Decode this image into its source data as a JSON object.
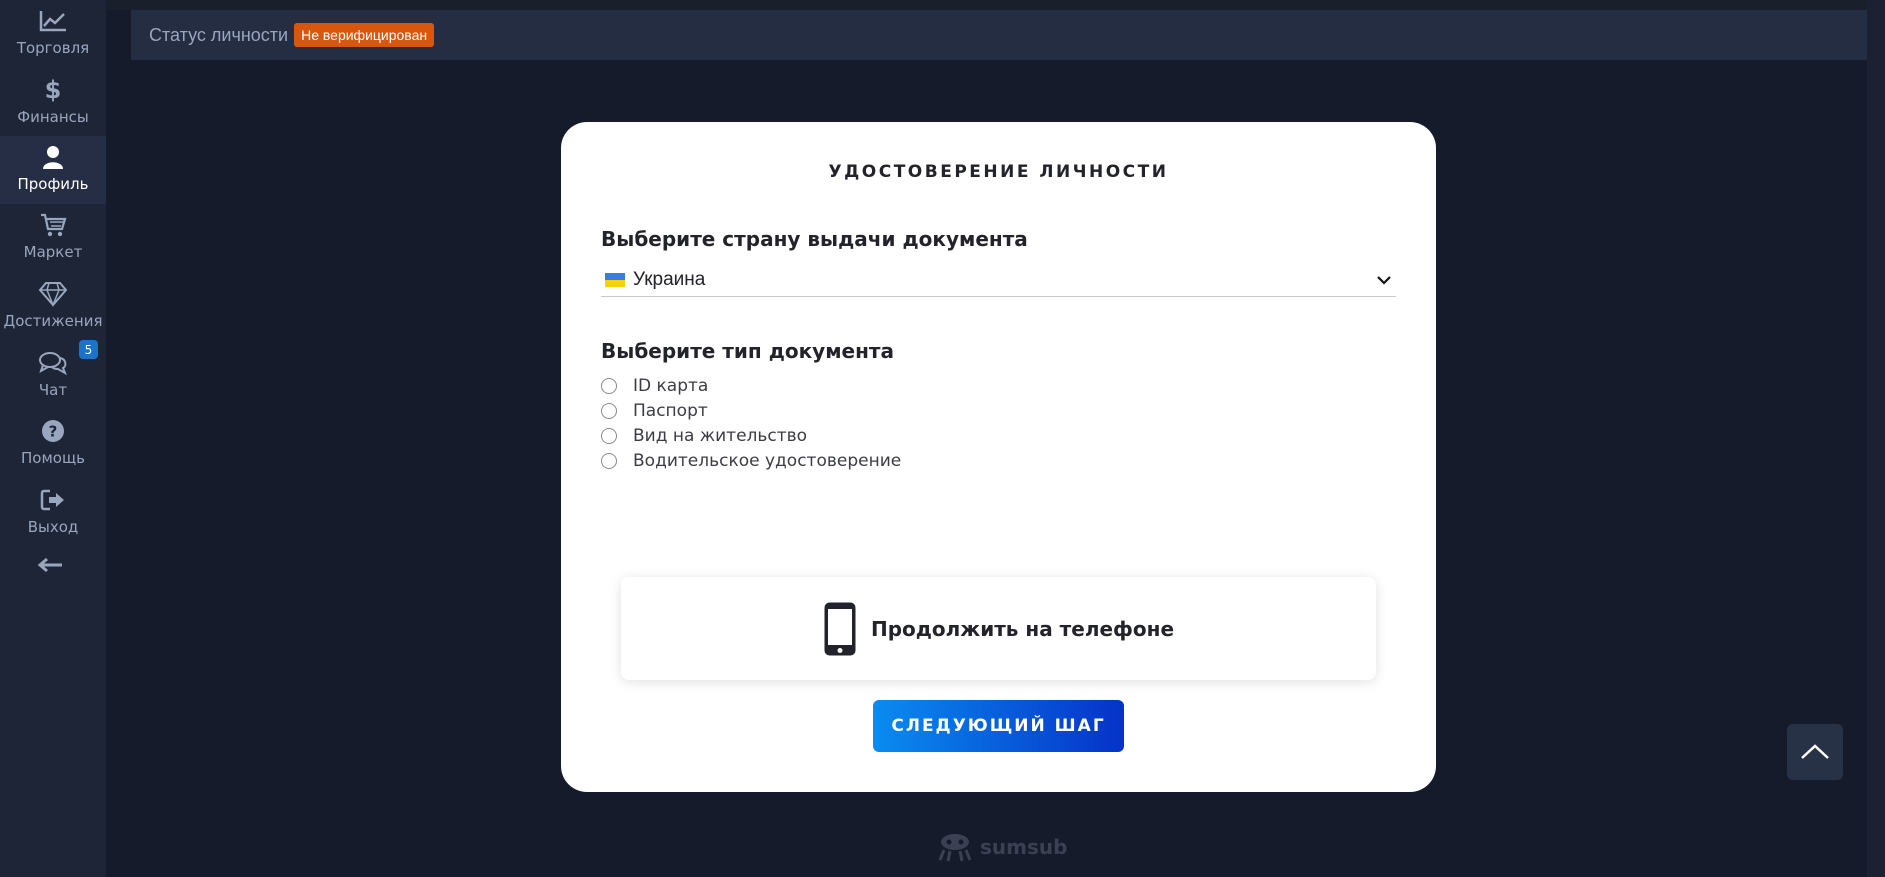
{
  "sidebar": {
    "items": [
      {
        "label": "Торговля",
        "icon": "chart-line-icon"
      },
      {
        "label": "Финансы",
        "icon": "dollar-icon"
      },
      {
        "label": "Профиль",
        "icon": "user-icon"
      },
      {
        "label": "Маркет",
        "icon": "cart-icon"
      },
      {
        "label": "Достижения",
        "icon": "diamond-icon"
      },
      {
        "label": "Чат",
        "icon": "chat-icon"
      },
      {
        "label": "Помощь",
        "icon": "question-icon"
      },
      {
        "label": "Выход",
        "icon": "exit-icon"
      }
    ],
    "active": "Профиль",
    "chat_badge": "5",
    "back_icon": "arrow-left-icon"
  },
  "header": {
    "title": "Статус личности",
    "status_badge": "Не верифицирован"
  },
  "modal": {
    "heading": "УДОСТОВЕРЕНИЕ ЛИЧНОСТИ",
    "country_label": "Выберите страну выдачи документа",
    "country_value": "Украина",
    "doc_type_label": "Выберите тип документа",
    "doc_types": [
      "ID карта",
      "Паспорт",
      "Вид на жительство",
      "Водительское удостоверение"
    ],
    "phone_option": "Продолжить на телефоне",
    "next_button": "СЛЕДУЮЩИЙ ШАГ"
  },
  "footer": {
    "brand": "sumsub"
  },
  "colors": {
    "background": "#161b2c",
    "sidebar": "#1d2537",
    "status_badge": "#d9570d",
    "button_start": "#0a8cf0",
    "button_end": "#0532c8"
  }
}
